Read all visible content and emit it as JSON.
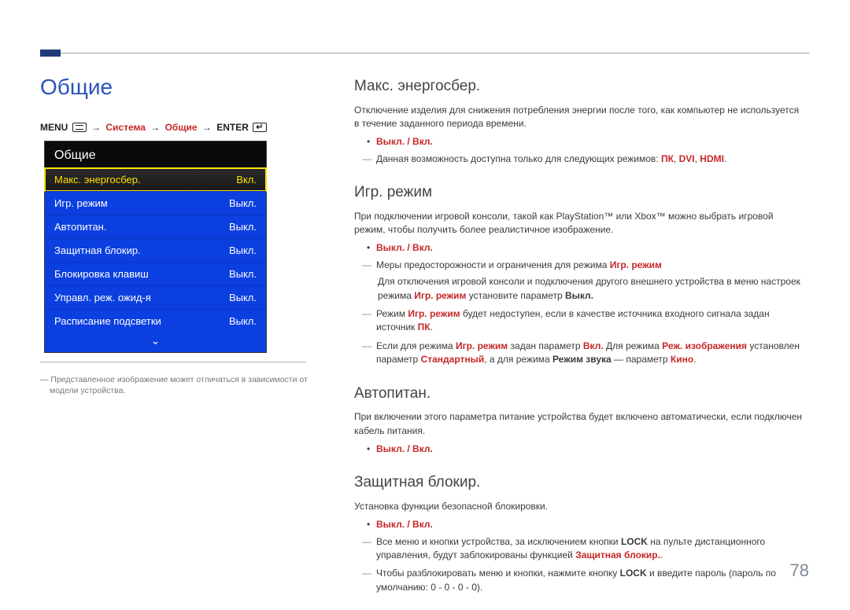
{
  "page_number": "78",
  "page_title": "Общие",
  "breadcrumb": {
    "menu": "MENU",
    "system": "Система",
    "general": "Общие",
    "enter": "ENTER"
  },
  "osd": {
    "title": "Общие",
    "items": [
      {
        "label": "Макс. энергосбер.",
        "value": "Вкл.",
        "selected": true
      },
      {
        "label": "Игр. режим",
        "value": "Выкл."
      },
      {
        "label": "Автопитан.",
        "value": "Выкл."
      },
      {
        "label": "Защитная блокир.",
        "value": "Выкл."
      },
      {
        "label": "Блокировка клавиш",
        "value": "Выкл."
      },
      {
        "label": "Управл. реж. ожид-я",
        "value": "Выкл."
      },
      {
        "label": "Расписание подсветки",
        "value": "Выкл."
      }
    ]
  },
  "left_note": "Представленное изображение может отличаться в зависимости от модели устройства.",
  "sec1": {
    "h": "Макс. энергосбер.",
    "p1": "Отключение изделия для снижения потребления энергии после того, как компьютер не используется в течение заданного периода времени.",
    "opt": "Выкл. / Вкл.",
    "d1a": "Данная возможность доступна только для следующих режимов: ",
    "d1b": "ПК",
    "d1c": "DVI",
    "d1d": "HDMI"
  },
  "sec2": {
    "h": "Игр. режим",
    "p1": "При подключении игровой консоли, такой как PlayStation™ или Xbox™ можно выбрать игровой режим, чтобы получить более реалистичное изображение.",
    "opt": "Выкл. / Вкл.",
    "d1a": "Меры предосторожности и ограничения для режима ",
    "d1b": "Игр. режим",
    "d1sub": "Для отключения игровой консоли и подключения другого внешнего устройства в меню настроек режима ",
    "d1subA": "Игр. режим",
    "d1subB": " установите параметр ",
    "d1subC": "Выкл.",
    "d2a": "Режим ",
    "d2b": "Игр. режим",
    "d2c": " будет недоступен, если в качестве источника входного сигнала задан источник ",
    "d2d": "ПК",
    "d3a": "Если для режима ",
    "d3b": "Игр. режим",
    "d3c": " задан параметр ",
    "d3d": "Вкл.",
    "d3e": " Для режима ",
    "d3f": "Реж. изображения",
    "d3g": " установлен параметр ",
    "d3h": "Стандартный",
    "d3i": ", а для режима ",
    "d3j": "Режим звука",
    "d3k": " — параметр ",
    "d3l": "Кино"
  },
  "sec3": {
    "h": "Автопитан.",
    "p1": "При включении этого параметра питание устройства будет включено автоматически, если подключен кабель питания.",
    "opt": "Выкл. / Вкл."
  },
  "sec4": {
    "h": "Защитная блокир.",
    "p1": "Установка функции безопасной блокировки.",
    "opt": "Выкл. / Вкл.",
    "d1a": "Все меню и кнопки устройства, за исключением кнопки ",
    "d1b": "LOCK",
    "d1c": " на пульте дистанционного управления, будут заблокированы функцией ",
    "d1d": "Защитная блокир.",
    "d2a": "Чтобы разблокировать меню и кнопки, нажмите кнопку ",
    "d2b": "LOCK",
    "d2c": " и введите пароль (пароль по умолчанию: 0 - 0 - 0 - 0)."
  }
}
